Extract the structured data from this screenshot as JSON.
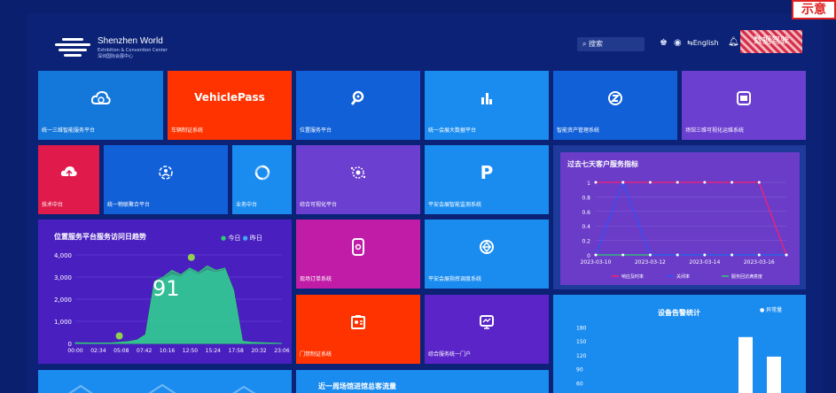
{
  "stamp": "示意",
  "header": {
    "logo_title": "Shenzhen World",
    "logo_subtitle_en": "Exhibition & Convention Center",
    "logo_subtitle_cn": "深圳国际会展中心",
    "search_placeholder": "搜索",
    "lang_label": "English",
    "user_label": "数据驾驶"
  },
  "tiles": [
    {
      "label": "统一三维智能服务平台",
      "icon": "cloud-icon",
      "color": "#1478db"
    },
    {
      "label": "车辆制证系统",
      "icon": "text-logo",
      "text": "VehiclePass",
      "color": "#ff3300"
    },
    {
      "label": "位置服务平台",
      "icon": "location-search-icon",
      "color": "#1160d8"
    },
    {
      "label": "统一会展大数据平台",
      "icon": "data-bars-icon",
      "color": "#1a8cf0"
    },
    {
      "label": "智能资产管理系统",
      "icon": "asset-icon",
      "color": "#1160d8"
    },
    {
      "label": "场馆三维可视化运维系统",
      "icon": "3d-box-icon",
      "color": "#6b3fd0"
    },
    {
      "label": "技术中台",
      "icon": "cloud-upload-icon",
      "color": "#e01a4a"
    },
    {
      "label": "统一物联聚合平台",
      "icon": "iot-icon",
      "color": "#1160d8"
    },
    {
      "label": "业务中台",
      "icon": "hub-icon",
      "color": "#1a8cf0"
    },
    {
      "label": "综合可视化平台",
      "icon": "visual-icon",
      "color": "#6b3fd0"
    },
    {
      "label": "平安会展智能监测系统",
      "icon": "p-icon",
      "text": "P",
      "color": "#1a8cf0"
    },
    {
      "label": "现场订单系统",
      "icon": "phone-order-icon",
      "color": "#c11ca8"
    },
    {
      "label": "平安会展指挥调度系统",
      "icon": "dispatch-icon",
      "color": "#1a8cf0"
    },
    {
      "label": "门禁制证系统",
      "icon": "badge-icon",
      "color": "#ff3300"
    },
    {
      "label": "综合服务统一门户",
      "icon": "portal-icon",
      "color": "#5a24c8"
    }
  ],
  "visits": {
    "title": "位置服务平台服务访问日趋势",
    "legend": [
      "今日",
      "昨日"
    ],
    "colors": {
      "today": "#2ecc71",
      "yesterday": "#3fa9f5"
    },
    "big_number": "91"
  },
  "weekly": {
    "title": "过去七天客户服务指标"
  },
  "alarm": {
    "title": "设备告警统计",
    "legend": "异常量"
  },
  "bottom": {
    "title": "近一周场馆进馆总客流量"
  },
  "chart_data": [
    {
      "type": "area",
      "title": "位置服务平台服务访问日趋势",
      "x_ticks": [
        "00:00",
        "02:34",
        "05:08",
        "07:42",
        "10:16",
        "12:50",
        "15:24",
        "17:58",
        "20:32",
        "23:06"
      ],
      "y_ticks": [
        "0",
        "1,000",
        "2,000",
        "3,000",
        "4,000"
      ],
      "ylim": [
        0,
        4000
      ],
      "series": [
        {
          "name": "今日",
          "x": [
            0,
            2,
            4,
            6,
            7,
            8,
            9,
            10,
            11,
            12,
            13,
            14,
            15,
            16,
            17,
            18,
            19,
            20,
            22,
            23.5
          ],
          "values": [
            30,
            20,
            20,
            80,
            150,
            400,
            2800,
            3000,
            3300,
            3100,
            3400,
            3200,
            3500,
            3300,
            3400,
            2400,
            100,
            50,
            20,
            0
          ]
        },
        {
          "name": "昨日",
          "x": [
            0,
            2,
            4,
            6,
            7,
            8,
            9,
            10,
            11,
            12,
            13,
            14,
            15,
            16,
            17,
            18,
            19,
            20,
            22,
            23.5
          ],
          "values": [
            20,
            15,
            15,
            60,
            120,
            350,
            2600,
            2900,
            3100,
            3000,
            3300,
            3100,
            3300,
            3200,
            3300,
            2300,
            80,
            40,
            15,
            0
          ]
        }
      ],
      "markers": [
        {
          "x": 5.0,
          "y": 100
        },
        {
          "x": 13.2,
          "y": 3650
        }
      ]
    },
    {
      "type": "line",
      "title": "过去七天客户服务指标",
      "x_ticks": [
        "2023-03-10",
        "2023-03-12",
        "2023-03-14",
        "2023-03-16"
      ],
      "y_ticks": [
        "0",
        "0.2",
        "0.4",
        "0.6",
        "0.8",
        "1"
      ],
      "ylim": [
        0,
        1
      ],
      "series": [
        {
          "name": "响应及时率",
          "color": "#ff1f6b",
          "values": [
            1,
            1,
            1,
            1,
            1,
            1,
            1,
            0
          ]
        },
        {
          "name": "关闭率",
          "color": "#2a55ff",
          "values": [
            0,
            1,
            0,
            0,
            0,
            0,
            0,
            0
          ]
        },
        {
          "name": "服务回访满意度",
          "color": "#2ecc71",
          "values": [
            0,
            0,
            0,
            0,
            0,
            0,
            0,
            0
          ]
        }
      ]
    },
    {
      "type": "bar",
      "title": "设备告警统计",
      "y_ticks": [
        "60",
        "90",
        "120",
        "150",
        "180"
      ],
      "ylim": [
        40,
        190
      ],
      "series": [
        {
          "name": "异常量",
          "values": [
            160,
            118
          ]
        }
      ]
    }
  ]
}
